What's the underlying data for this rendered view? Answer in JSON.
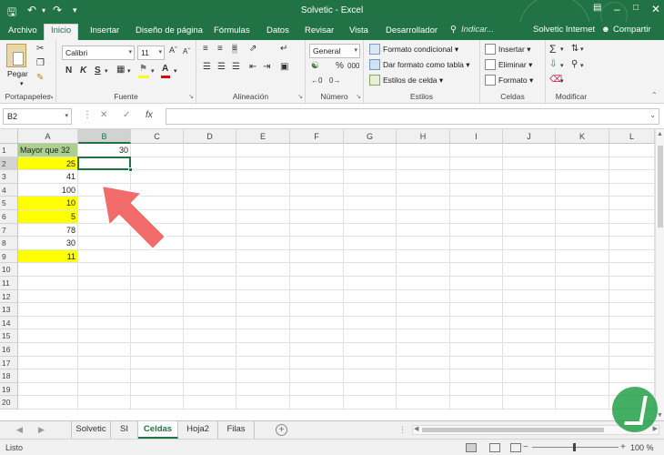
{
  "window": {
    "title": "Solvetic - Excel",
    "account": "Solvetic Internet",
    "share": "Compartir",
    "tell_me": "Indicar..."
  },
  "tabs": [
    "Archivo",
    "Inicio",
    "Insertar",
    "Diseño de página",
    "Fórmulas",
    "Datos",
    "Revisar",
    "Vista",
    "Desarrollador"
  ],
  "active_tab": "Inicio",
  "ribbon": {
    "portapapeles": {
      "label": "Portapapeles",
      "paste": "Pegar"
    },
    "fuente": {
      "label": "Fuente",
      "font_name": "Calibri",
      "font_size": "11",
      "bold": "N",
      "italic": "K",
      "underline": "S"
    },
    "alineacion": {
      "label": "Alineación"
    },
    "numero": {
      "label": "Número",
      "format": "General",
      "percent": "%",
      "thousands": "000"
    },
    "estilos": {
      "label": "Estilos",
      "cond_format": "Formato condicional",
      "table_format": "Dar formato como tabla",
      "cell_styles": "Estilos de celda"
    },
    "celdas": {
      "label": "Celdas",
      "insert": "Insertar",
      "delete": "Eliminar",
      "format": "Formato"
    },
    "modificar": {
      "label": "Modificar"
    }
  },
  "formula_bar": {
    "name_box": "B2",
    "fx": "fx",
    "content": ""
  },
  "columns": [
    "A",
    "B",
    "C",
    "D",
    "E",
    "F",
    "G",
    "H",
    "I",
    "J",
    "K",
    "L"
  ],
  "rows": [
    "1",
    "2",
    "3",
    "4",
    "5",
    "6",
    "7",
    "8",
    "9",
    "10",
    "11",
    "12",
    "13",
    "14",
    "15",
    "16",
    "17",
    "18",
    "19",
    "20"
  ],
  "cells": {
    "A1": {
      "value": "Mayor que 32",
      "fill": "#a9d08e"
    },
    "B1": {
      "value": "30"
    },
    "A2": {
      "value": "25",
      "fill": "#ffff00"
    },
    "A3": {
      "value": "41"
    },
    "A4": {
      "value": "100"
    },
    "A5": {
      "value": "10",
      "fill": "#ffff00"
    },
    "A6": {
      "value": "5",
      "fill": "#ffff00"
    },
    "A7": {
      "value": "78"
    },
    "A8": {
      "value": "30"
    },
    "A9": {
      "value": "11",
      "fill": "#ffff00"
    }
  },
  "active_cell": "B2",
  "sheets": [
    "Solvetic",
    "SI",
    "Celdas",
    "Hoja2",
    "Filas"
  ],
  "active_sheet": "Celdas",
  "status": {
    "text": "Listo",
    "zoom": "100 %"
  },
  "colors": {
    "accent": "#217346",
    "highlight_yellow": "#ffff00",
    "header_green": "#a9d08e",
    "arrow": "#f26b6b"
  }
}
